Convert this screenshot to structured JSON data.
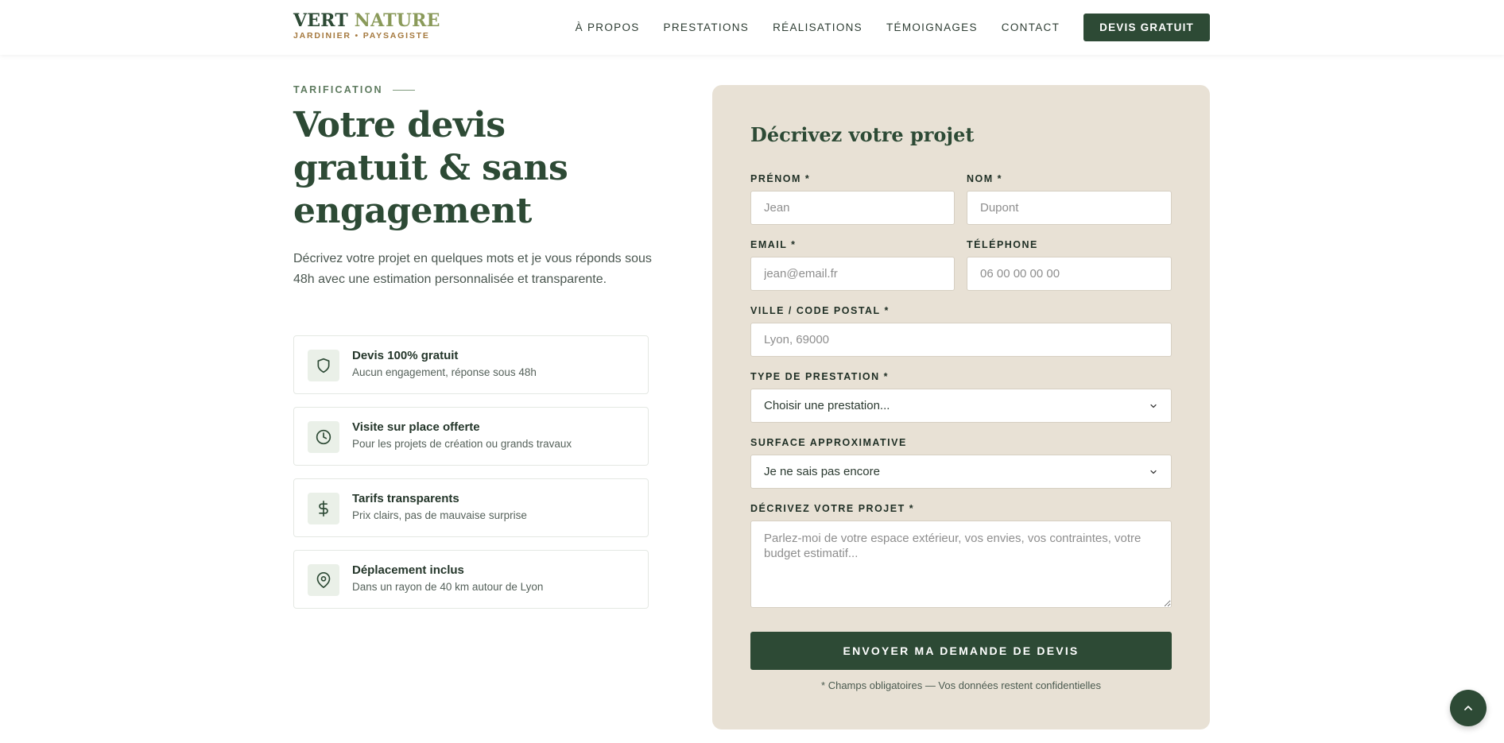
{
  "header": {
    "logo_word1": "VERT",
    "logo_word2": "NATURE",
    "logo_tagline": "JARDINIER • PAYSAGISTE",
    "nav": [
      "À PROPOS",
      "PRESTATIONS",
      "RÉALISATIONS",
      "TÉMOIGNAGES",
      "CONTACT"
    ],
    "cta": "DEVIS GRATUIT"
  },
  "intro": {
    "eyebrow": "TARIFICATION",
    "headline": "Votre devis gratuit & sans engagement",
    "text": "Décrivez votre projet en quelques mots et je vous réponds sous 48h avec une estimation personnalisée et transparente."
  },
  "features": [
    {
      "icon": "shield-icon",
      "title": "Devis 100% gratuit",
      "desc": "Aucun engagement, réponse sous 48h"
    },
    {
      "icon": "clock-icon",
      "title": "Visite sur place offerte",
      "desc": "Pour les projets de création ou grands travaux"
    },
    {
      "icon": "dollar-icon",
      "title": "Tarifs transparents",
      "desc": "Prix clairs, pas de mauvaise surprise"
    },
    {
      "icon": "map-pin-icon",
      "title": "Déplacement inclus",
      "desc": "Dans un rayon de 40 km autour de Lyon"
    }
  ],
  "form": {
    "title": "Décrivez votre projet",
    "firstname_label": "PRÉNOM *",
    "firstname_placeholder": "Jean",
    "lastname_label": "NOM *",
    "lastname_placeholder": "Dupont",
    "email_label": "EMAIL *",
    "email_placeholder": "jean@email.fr",
    "phone_label": "TÉLÉPHONE",
    "phone_placeholder": "06 00 00 00 00",
    "city_label": "VILLE / CODE POSTAL *",
    "city_placeholder": "Lyon, 69000",
    "service_label": "TYPE DE PRESTATION *",
    "service_value": "Choisir une prestation...",
    "surface_label": "SURFACE APPROXIMATIVE",
    "surface_value": "Je ne sais pas encore",
    "project_label": "DÉCRIVEZ VOTRE PROJET *",
    "project_placeholder": "Parlez-moi de votre espace extérieur, vos envies, vos contraintes, votre budget estimatif...",
    "submit": "ENVOYER MA DEMANDE DE DEVIS",
    "note": "* Champs obligatoires — Vos données restent confidentielles"
  },
  "colors": {
    "primary": "#2d4a35",
    "accent": "#8a9a5a",
    "tagline": "#a5793e",
    "card_bg": "#e8e1d5"
  }
}
